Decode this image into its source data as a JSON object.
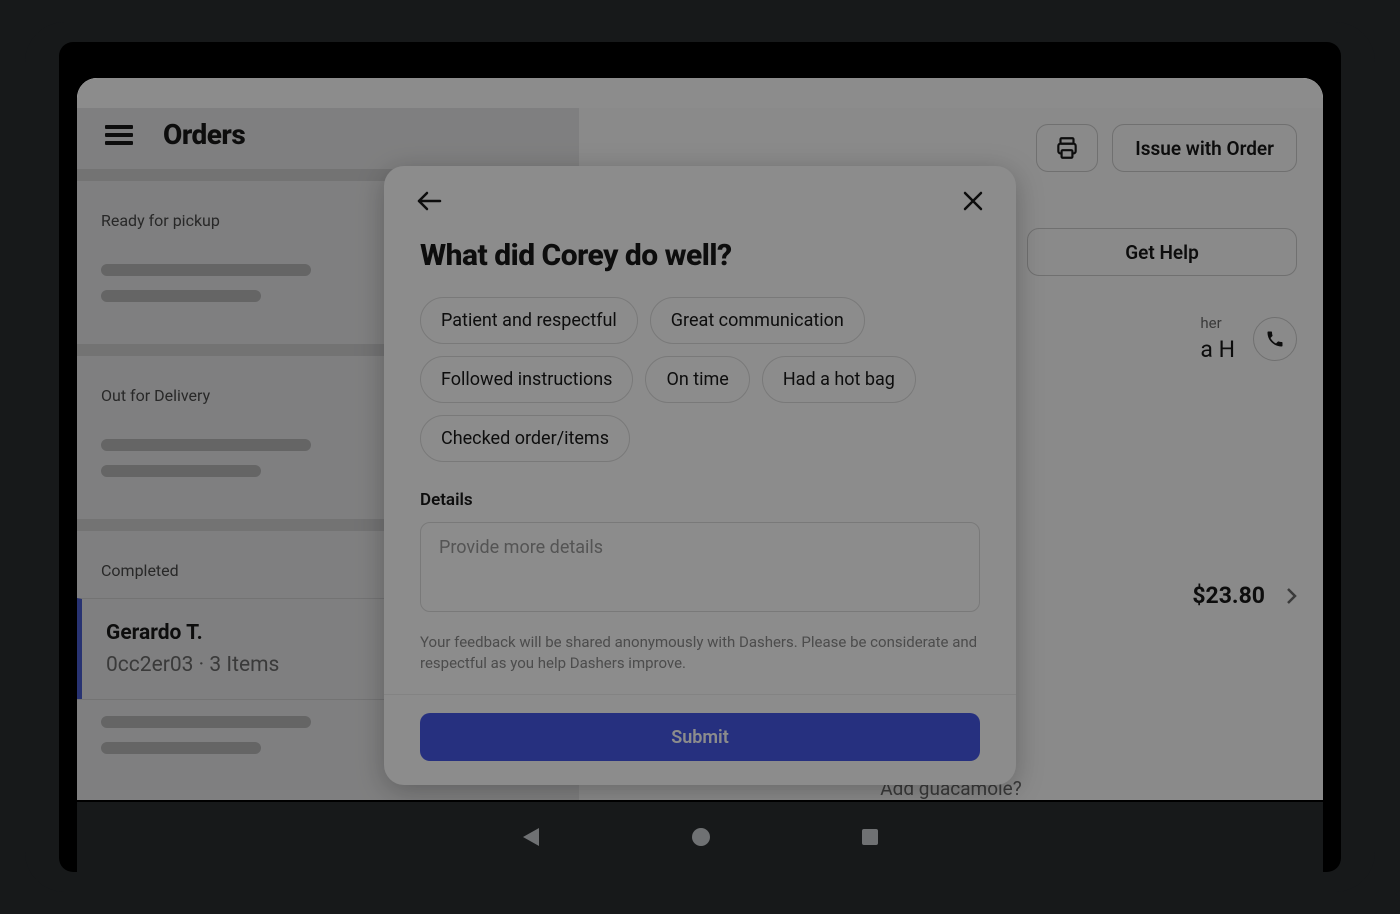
{
  "header": {
    "page_title": "Orders",
    "print_label": "Print",
    "issue_with_order": "Issue with Order"
  },
  "sections": {
    "ready": "Ready for pickup",
    "out": "Out for Delivery",
    "completed": "Completed"
  },
  "selected_order": {
    "name": "Gerardo T.",
    "id_line": "0cc2er03 · 3 Items"
  },
  "main": {
    "get_help": "Get Help",
    "dasher_label": "her",
    "dasher_name": "a H",
    "price": "$23.80",
    "guac": "Add guacamole?"
  },
  "modal": {
    "title": "What did Corey do well?",
    "chips": [
      "Patient and respectful",
      "Great communication",
      "Followed instructions",
      "On time",
      "Had a hot bag",
      "Checked order/items"
    ],
    "details_label": "Details",
    "placeholder": "Provide more details",
    "disclaimer": "Your feedback will be shared anonymously with Dashers. Please be considerate and respectful as you help Dashers improve.",
    "submit": "Submit"
  }
}
